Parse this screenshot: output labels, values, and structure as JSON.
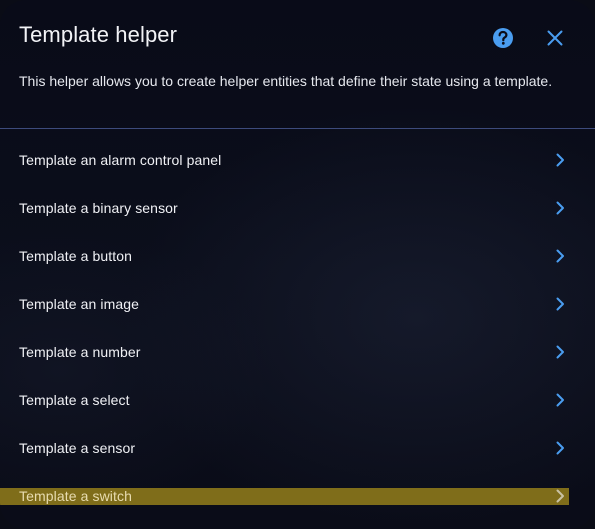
{
  "dialog": {
    "title": "Template helper",
    "description": "This helper allows you to create helper entities that define their state using a template.",
    "help_icon": "help-circle-icon",
    "close_icon": "close-icon",
    "accent_color": "#4a9df0",
    "highlight_color": "#7f6d1a"
  },
  "items": [
    {
      "label": "Template an alarm control panel",
      "icon": "chevron-right-icon"
    },
    {
      "label": "Template a binary sensor",
      "icon": "chevron-right-icon"
    },
    {
      "label": "Template a button",
      "icon": "chevron-right-icon"
    },
    {
      "label": "Template an image",
      "icon": "chevron-right-icon"
    },
    {
      "label": "Template a number",
      "icon": "chevron-right-icon"
    },
    {
      "label": "Template a select",
      "icon": "chevron-right-icon"
    },
    {
      "label": "Template a sensor",
      "icon": "chevron-right-icon"
    },
    {
      "label": "Template a switch",
      "icon": "chevron-right-icon",
      "highlighted": true
    }
  ]
}
